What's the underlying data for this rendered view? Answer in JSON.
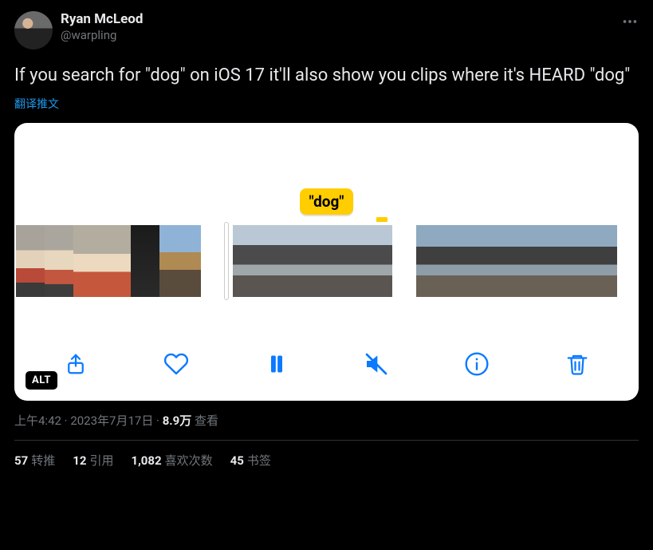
{
  "user": {
    "name": "Ryan McLeod",
    "handle": "@warpling"
  },
  "tweet_text": "If you search for \"dog\" on iOS 17 it'll also show you clips where it's HEARD \"dog\"",
  "translate_label": "翻译推文",
  "media": {
    "dog_label": "\"dog\"",
    "alt_badge": "ALT"
  },
  "meta": {
    "time": "上午4:42",
    "dot": " · ",
    "date": "2023年7月17日",
    "views_count": "8.9万",
    "views_label": " 查看"
  },
  "stats": {
    "retweets_count": "57",
    "retweets_label": "转推",
    "quotes_count": "12",
    "quotes_label": "引用",
    "likes_count": "1,082",
    "likes_label": "喜欢次数",
    "bookmarks_count": "45",
    "bookmarks_label": "书签"
  }
}
